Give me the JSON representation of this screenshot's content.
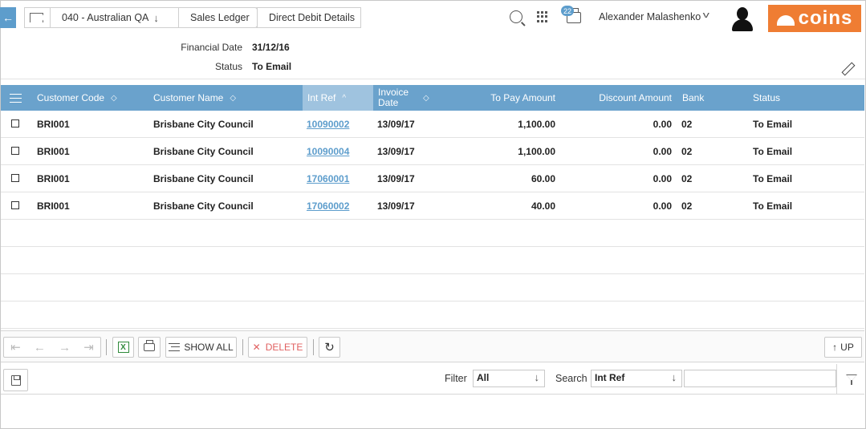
{
  "breadcrumb": {
    "back_icon": "back-arrow-icon",
    "home_icon": "home-tab-icon",
    "items": [
      {
        "label": "040 - Australian QA",
        "chevron": "↓"
      },
      {
        "label": "Sales Ledger"
      },
      {
        "label": "Direct Debit Details"
      }
    ]
  },
  "header": {
    "notification_count": "22",
    "user_name": "Alexander Malashenko",
    "logo_text": "coins",
    "logo_color": "#ef7d33"
  },
  "info": {
    "financial_date_label": "Financial Date",
    "financial_date_value": "31/12/16",
    "status_label": "Status",
    "status_value": "To Email"
  },
  "grid": {
    "header_color": "#6aa2cc",
    "columns": [
      {
        "key": "customer_code",
        "label": "Customer Code",
        "sortable": true
      },
      {
        "key": "customer_name",
        "label": "Customer Name",
        "sortable": true
      },
      {
        "key": "int_ref",
        "label": "Int Ref",
        "sort": "ascending"
      },
      {
        "key": "invoice_date",
        "label": "Invoice Date",
        "label_line1": "Invoice",
        "label_line2": "Date",
        "sortable": true
      },
      {
        "key": "to_pay_amount",
        "label": "To Pay Amount"
      },
      {
        "key": "discount_amount",
        "label": "Discount Amount"
      },
      {
        "key": "bank",
        "label": "Bank"
      },
      {
        "key": "status",
        "label": "Status"
      }
    ],
    "rows": [
      {
        "customer_code": "BRI001",
        "customer_name": "Brisbane City Council",
        "int_ref": "10090002",
        "invoice_date": "13/09/17",
        "to_pay_amount": "1,100.00",
        "discount_amount": "0.00",
        "bank": "02",
        "status": "To Email"
      },
      {
        "customer_code": "BRI001",
        "customer_name": "Brisbane City Council",
        "int_ref": "10090004",
        "invoice_date": "13/09/17",
        "to_pay_amount": "1,100.00",
        "discount_amount": "0.00",
        "bank": "02",
        "status": "To Email"
      },
      {
        "customer_code": "BRI001",
        "customer_name": "Brisbane City Council",
        "int_ref": "17060001",
        "invoice_date": "13/09/17",
        "to_pay_amount": "60.00",
        "discount_amount": "0.00",
        "bank": "02",
        "status": "To Email"
      },
      {
        "customer_code": "BRI001",
        "customer_name": "Brisbane City Council",
        "int_ref": "17060002",
        "invoice_date": "13/09/17",
        "to_pay_amount": "40.00",
        "discount_amount": "0.00",
        "bank": "02",
        "status": "To Email"
      }
    ]
  },
  "toolbar": {
    "excel_glyph": "X",
    "show_all_label": "SHOW ALL",
    "delete_label": "DELETE",
    "up_label": "UP"
  },
  "filter_bar": {
    "filter_label": "Filter",
    "filter_value": "All",
    "search_label": "Search",
    "search_field_value": "Int Ref",
    "search_input_value": ""
  }
}
